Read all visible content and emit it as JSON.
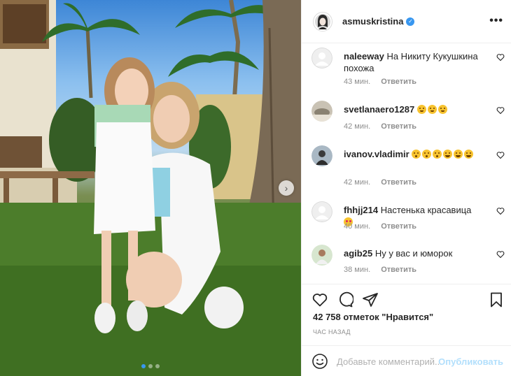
{
  "post": {
    "username": "asmuskristina",
    "verified": true,
    "more_label": "•••"
  },
  "photo": {
    "carousel": {
      "current_slide": 1,
      "total_slides": 3
    }
  },
  "comments": [
    {
      "user": "naleeway",
      "text": "На Никиту Кукушкина похожа",
      "emojis": [],
      "time": "43 мин.",
      "reply": "Ответить",
      "avatar": "default"
    },
    {
      "user": "svetlanaero1287",
      "text": "",
      "emojis": [
        "tear",
        "tear",
        "tear"
      ],
      "time": "42 мин.",
      "reply": "Ответить",
      "avatar": "photo"
    },
    {
      "user": "ivanov.vladimir",
      "text": "",
      "emojis": [
        "wow",
        "wow",
        "wow",
        "smile",
        "smile",
        "smile"
      ],
      "time": "42 мин.",
      "reply": "Ответить",
      "avatar": "photo"
    },
    {
      "user": "fhhjj214",
      "text": "Настенька красавица",
      "emojis": [
        "love"
      ],
      "time": "40 мин.",
      "reply": "Ответить",
      "avatar": "default"
    },
    {
      "user": "agib25",
      "text": "Ну у вас и юморок",
      "emojis": [],
      "time": "38 мин.",
      "reply": "Ответить",
      "avatar": "photo"
    }
  ],
  "likes": "42 758 отметок \"Нравится\"",
  "timestamp": "час назад",
  "add_comment": {
    "placeholder": "Добавьте комментарий...",
    "post_label": "Опубликовать"
  },
  "colors": {
    "accent": "#3897f0",
    "post_disabled": "#b2dffc",
    "muted": "#8e8e8e"
  }
}
